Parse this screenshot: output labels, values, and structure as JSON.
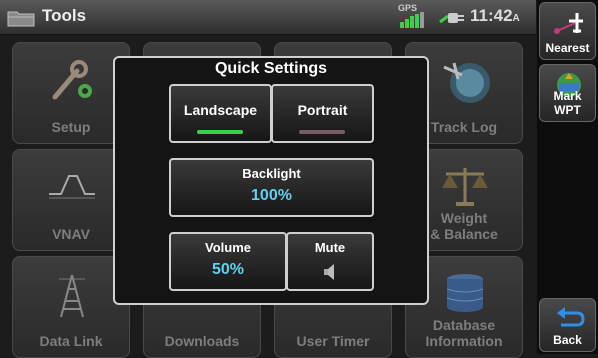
{
  "header": {
    "title": "Tools",
    "gps_label": "GPS",
    "time": "11:42",
    "time_suffix": "A"
  },
  "tiles": [
    {
      "label": "Setup"
    },
    {
      "label": ""
    },
    {
      "label": ""
    },
    {
      "label": "Track Log"
    },
    {
      "label": "VNAV"
    },
    {
      "label": "Weight\n& Balance"
    },
    {
      "label": "Data Link"
    },
    {
      "label": "Downloads"
    },
    {
      "label": "User Timer"
    },
    {
      "label": "Database\nInformation"
    }
  ],
  "sidebar": {
    "nearest": "Nearest",
    "mark_wpt": "Mark WPT",
    "back": "Back"
  },
  "modal": {
    "title": "Quick Settings",
    "landscape": "Landscape",
    "portrait": "Portrait",
    "backlight_label": "Backlight",
    "backlight_value": "100%",
    "volume_label": "Volume",
    "volume_value": "50%",
    "mute_label": "Mute"
  },
  "colors": {
    "accent_value": "#5ed2ef",
    "landscape_on": "#39d14b",
    "portrait_off": "#7a5c66"
  },
  "icons": [
    "folder-icon",
    "gps-signal-icon",
    "plug-icon",
    "airplane-icon",
    "waypoint-icon",
    "back-arrow-icon",
    "speaker-icon",
    "wrench-gear-icon",
    "vnav-icon",
    "scale-icon",
    "antenna-icon",
    "track-log-icon",
    "database-icon"
  ]
}
